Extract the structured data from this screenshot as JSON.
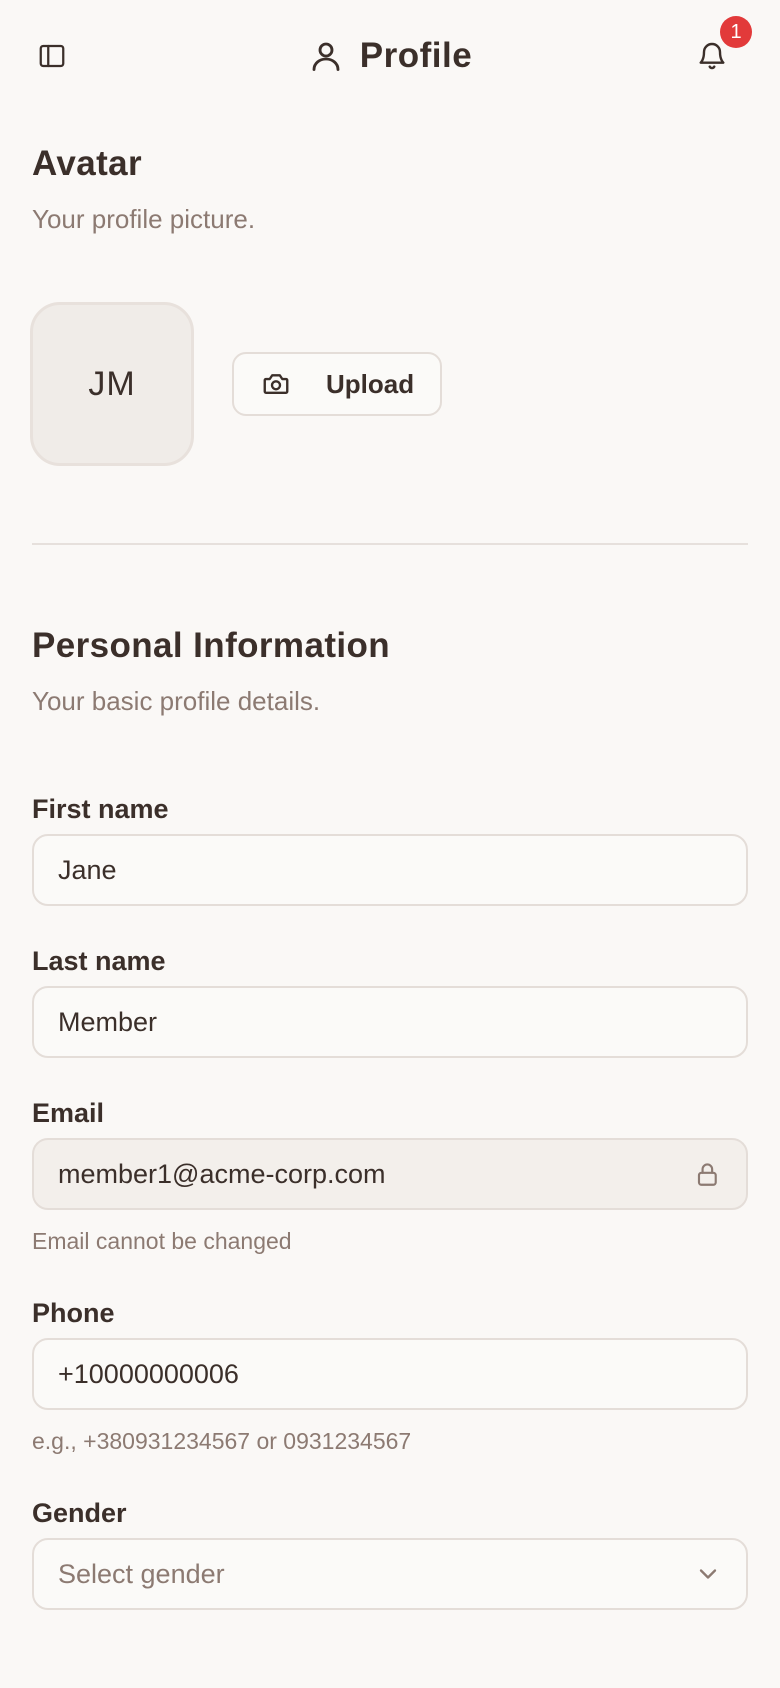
{
  "header": {
    "title": "Profile",
    "notification_count": "1"
  },
  "avatar_section": {
    "title": "Avatar",
    "subtitle": "Your profile picture.",
    "initials": "JM",
    "upload_label": "Upload"
  },
  "personal_section": {
    "title": "Personal Information",
    "subtitle": "Your basic profile details."
  },
  "fields": {
    "first_name": {
      "label": "First name",
      "value": "Jane"
    },
    "last_name": {
      "label": "Last name",
      "value": "Member"
    },
    "email": {
      "label": "Email",
      "value": "member1@acme-corp.com",
      "hint": "Email cannot be changed"
    },
    "phone": {
      "label": "Phone",
      "value": "+10000000006",
      "hint": "e.g., +380931234567 or 0931234567"
    },
    "gender": {
      "label": "Gender",
      "placeholder": "Select gender"
    }
  },
  "icons": {
    "sidebar": "sidebar-toggle-icon",
    "user": "user-icon",
    "bell": "bell-icon",
    "camera": "camera-icon",
    "lock": "lock-icon",
    "chevron": "chevron-down-icon"
  },
  "colors": {
    "background": "#faf8f6",
    "text": "#3b2f2a",
    "muted": "#8c7a72",
    "badge": "#e23a3a"
  }
}
